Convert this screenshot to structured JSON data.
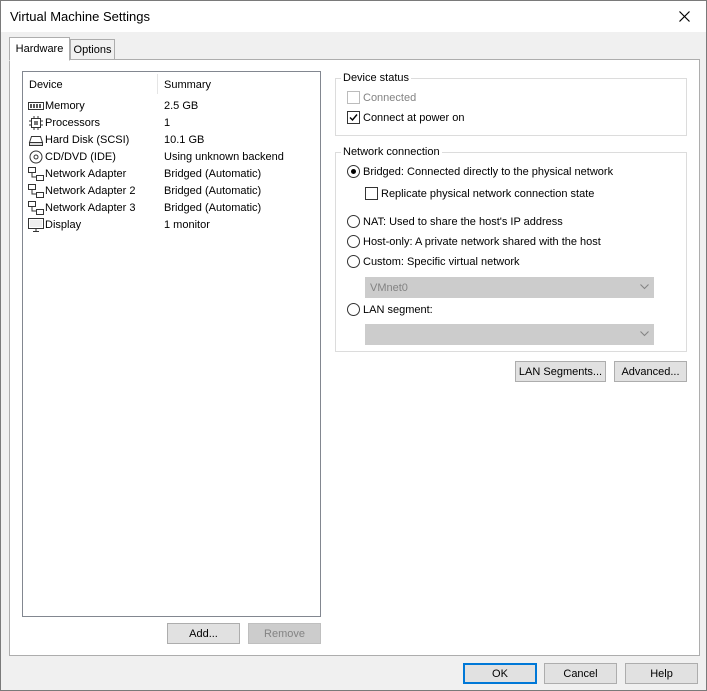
{
  "window": {
    "title": "Virtual Machine Settings"
  },
  "tabs": [
    {
      "label": "Hardware",
      "active": true
    },
    {
      "label": "Options",
      "active": false
    }
  ],
  "device_list": {
    "headers": {
      "device": "Device",
      "summary": "Summary"
    },
    "devices": [
      {
        "icon": "memory-icon",
        "name": "Memory",
        "summary": "2.5 GB"
      },
      {
        "icon": "processor-icon",
        "name": "Processors",
        "summary": "1"
      },
      {
        "icon": "hard-disk-icon",
        "name": "Hard Disk (SCSI)",
        "summary": "10.1 GB"
      },
      {
        "icon": "cd-dvd-icon",
        "name": "CD/DVD (IDE)",
        "summary": "Using unknown backend"
      },
      {
        "icon": "network-adapter-icon",
        "name": "Network Adapter",
        "summary": "Bridged (Automatic)"
      },
      {
        "icon": "network-adapter-icon",
        "name": "Network Adapter 2",
        "summary": "Bridged (Automatic)"
      },
      {
        "icon": "network-adapter-icon",
        "name": "Network Adapter 3",
        "summary": "Bridged (Automatic)"
      },
      {
        "icon": "display-icon",
        "name": "Display",
        "summary": "1 monitor"
      }
    ],
    "add_label": "Add...",
    "remove_label": "Remove"
  },
  "device_status": {
    "legend": "Device status",
    "connected": {
      "label": "Connected",
      "checked": false,
      "enabled": false
    },
    "connect_at_power_on": {
      "label": "Connect at power on",
      "checked": true
    }
  },
  "network_connection": {
    "legend": "Network connection",
    "bridged": {
      "label": "Bridged: Connected directly to the physical network",
      "selected": true
    },
    "replicate": {
      "label": "Replicate physical network connection state",
      "checked": false
    },
    "nat": {
      "label": "NAT: Used to share the host's IP address",
      "selected": false
    },
    "host_only": {
      "label": "Host-only: A private network shared with the host",
      "selected": false
    },
    "custom": {
      "label": "Custom: Specific virtual network",
      "selected": false
    },
    "custom_select_value": "VMnet0",
    "lan_segment": {
      "label": "LAN segment:",
      "selected": false
    },
    "lan_segment_value": ""
  },
  "network_buttons": {
    "lan_segments_label": "LAN Segments...",
    "advanced_label": "Advanced..."
  },
  "footer": {
    "ok_label": "OK",
    "cancel_label": "Cancel",
    "help_label": "Help"
  },
  "colors": {
    "accent": "#0078d7",
    "disabled_text": "#838383",
    "disabled_fill": "#cccccc"
  }
}
